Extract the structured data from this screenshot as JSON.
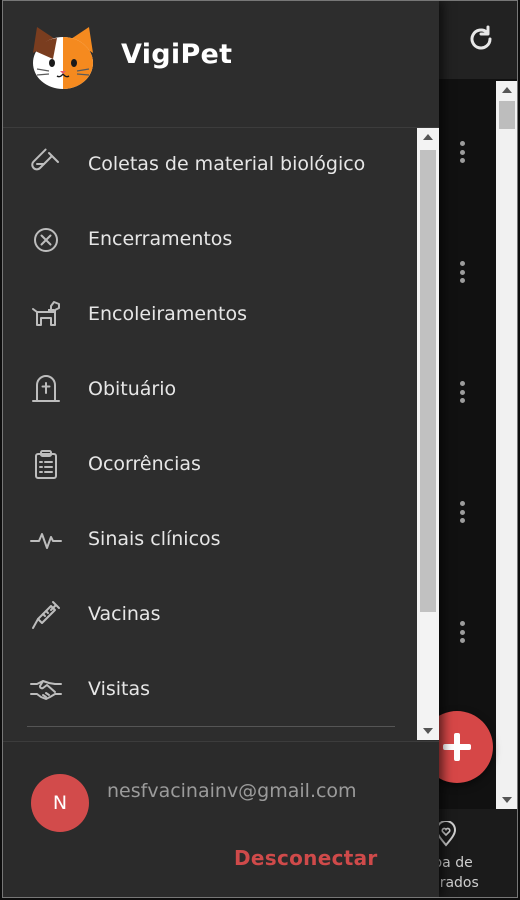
{
  "app": {
    "title": "VigiPet",
    "logo_icon": "cat-face-logo-icon"
  },
  "colors": {
    "drawer_bg": "#2d2d2d",
    "accent_red": "#d24b4b",
    "text_primary": "#e6e6e6",
    "text_muted": "#9b9b9b"
  },
  "menu": {
    "items": [
      {
        "label": "Coletas de material biológico",
        "icon": "test-tube-icon"
      },
      {
        "label": "Encerramentos",
        "icon": "x-circle-icon"
      },
      {
        "label": "Encoleiramentos",
        "icon": "dog-collar-icon"
      },
      {
        "label": "Obituário",
        "icon": "gravestone-icon"
      },
      {
        "label": "Ocorrências",
        "icon": "clipboard-list-icon"
      },
      {
        "label": "Sinais clínicos",
        "icon": "heartbeat-icon"
      },
      {
        "label": "Vacinas",
        "icon": "syringe-icon"
      },
      {
        "label": "Visitas",
        "icon": "handshake-icon"
      }
    ]
  },
  "user": {
    "avatar_initial": "N",
    "email": "nesfvacinainv@gmail.com",
    "logout_label": "Desconectar"
  },
  "background": {
    "refresh_icon": "refresh-icon",
    "fab_icon": "plus-icon",
    "bottom_nav_label": "pa de\neirados",
    "bottom_nav_icon": "map-pin-heart-icon"
  }
}
